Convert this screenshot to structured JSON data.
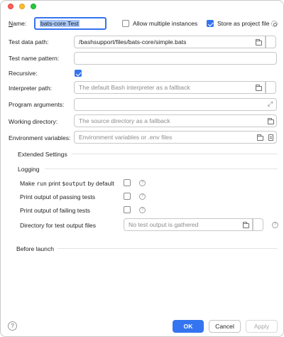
{
  "window": {
    "accent_color": "#3574f0"
  },
  "header": {
    "name_label": "Name:",
    "name_value": "bats-core Test",
    "allow_multiple_label": "Allow multiple instances",
    "allow_multiple_checked": false,
    "store_project_label": "Store as project file",
    "store_project_checked": true
  },
  "form": {
    "test_data_path_label": "Test data path:",
    "test_data_path_value": "/bashsupport/files/bats-core/simple.bats",
    "test_name_pattern_label": "Test name pattern:",
    "test_name_pattern_value": "",
    "recursive_label": "Recursive:",
    "recursive_checked": true,
    "interpreter_label": "Interpreter path:",
    "interpreter_placeholder": "The default Bash interpreter as a fallback",
    "program_args_label": "Program arguments:",
    "program_args_value": "",
    "working_dir_label": "Working directory:",
    "working_dir_placeholder": "The source directory as a fallback",
    "env_vars_label": "Environment variables:",
    "env_vars_placeholder": "Environment variables or .env files"
  },
  "extended": {
    "title": "Extended Settings"
  },
  "logging": {
    "title": "Logging",
    "make_run_prefix": "Make",
    "make_run_code1": "run",
    "make_run_mid": "print",
    "make_run_code2": "$output",
    "make_run_suffix": "by default",
    "make_run_checked": false,
    "print_passing_label": "Print output of passing tests",
    "print_passing_checked": false,
    "print_failing_label": "Print output of failing tests",
    "print_failing_checked": false,
    "output_dir_label": "Directory for test output files",
    "output_dir_placeholder": "No test output is gathered"
  },
  "before_launch": {
    "title": "Before launch"
  },
  "footer": {
    "help_glyph": "?",
    "ok_label": "OK",
    "cancel_label": "Cancel",
    "apply_label": "Apply"
  }
}
